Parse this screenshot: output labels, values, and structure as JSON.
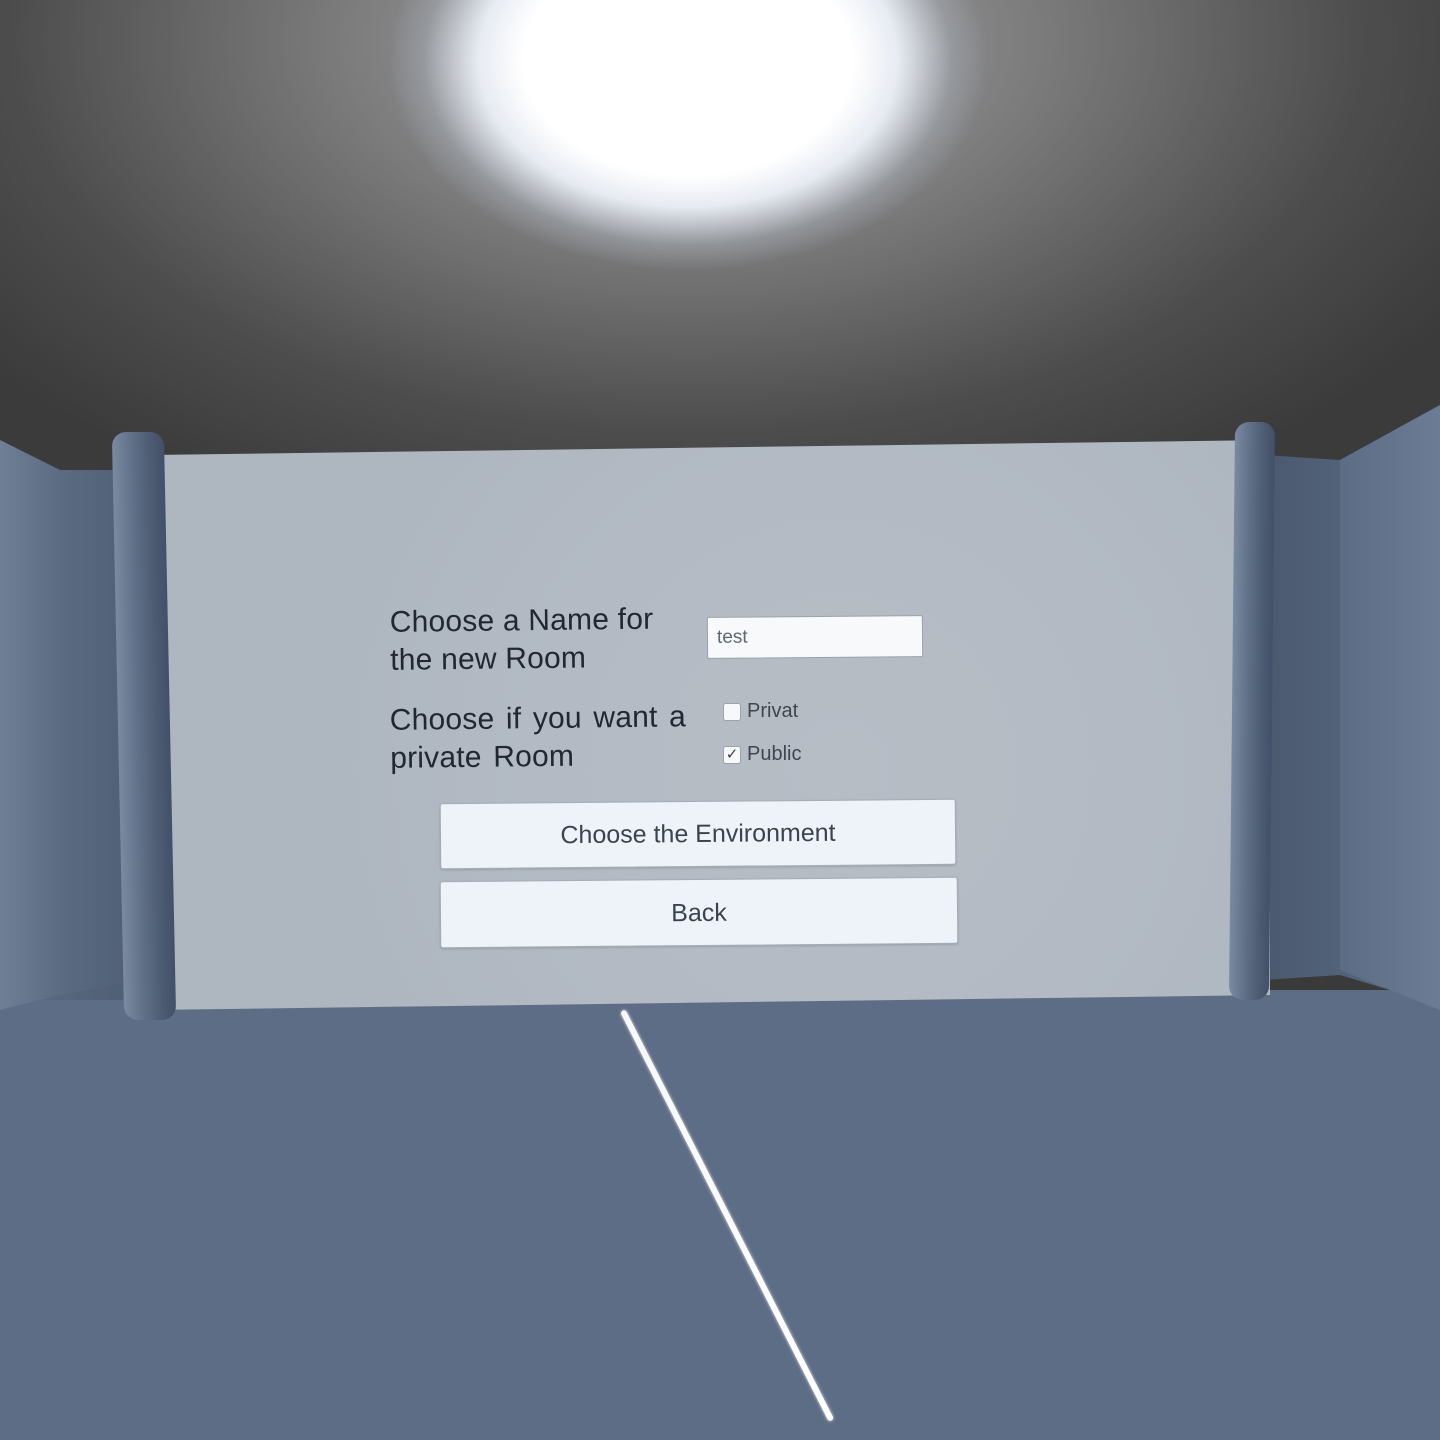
{
  "room_form": {
    "name_label": "Choose a Name for the new Room",
    "name_value": "test",
    "privacy_label": "Choose if you want a private Room",
    "options": [
      {
        "label": "Privat",
        "checked": false,
        "mark": ""
      },
      {
        "label": "Public",
        "checked": true,
        "mark": "✓"
      }
    ],
    "environment_button": "Choose the Environment",
    "back_button": "Back"
  },
  "colors": {
    "panel": "#b4bbc4",
    "button_bg": "#edf3f9",
    "text": "#222831",
    "pillar": "#55657c",
    "floor": "#7d8ba0"
  }
}
